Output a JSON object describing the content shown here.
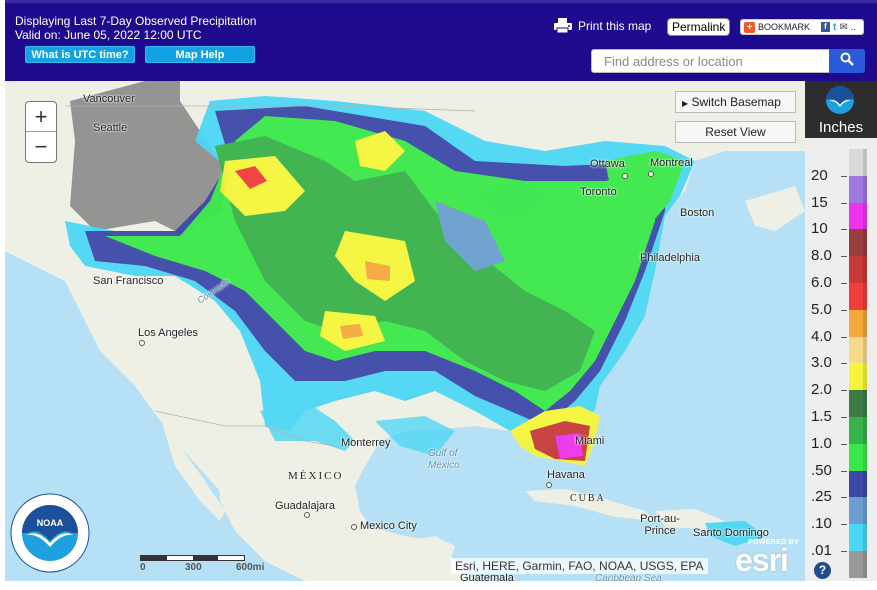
{
  "header": {
    "title_line1": "Displaying Last 7-Day Observed Precipitation",
    "title_line2": "Valid on: June 05, 2022 12:00 UTC",
    "utc_button": "What is UTC time?",
    "help_button": "Map Help",
    "print_label": "Print this map",
    "permalink_label": "Permalink",
    "bookmark_label": "BOOKMARK",
    "search_placeholder": "Find address or location"
  },
  "map": {
    "zoom_in": "+",
    "zoom_out": "−",
    "switch_basemap": "Switch Basemap",
    "reset_view": "Reset View",
    "attribution": "Esri, HERE, Garmin, FAO, NOAA, USGS, EPA",
    "esri_powered": "POWERED BY",
    "esri_logo": "esri",
    "scale": {
      "labels": [
        "0",
        "300",
        "600mi"
      ]
    },
    "places": [
      {
        "name": "Vancouver",
        "type": "city"
      },
      {
        "name": "Seattle",
        "type": "city"
      },
      {
        "name": "San Francisco",
        "type": "city"
      },
      {
        "name": "Los Angeles",
        "type": "city"
      },
      {
        "name": "Ottawa",
        "type": "city"
      },
      {
        "name": "Montreal",
        "type": "city"
      },
      {
        "name": "Toronto",
        "type": "city"
      },
      {
        "name": "Boston",
        "type": "city"
      },
      {
        "name": "Philadelphia",
        "type": "city"
      },
      {
        "name": "Monterrey",
        "type": "city"
      },
      {
        "name": "Miami",
        "type": "city"
      },
      {
        "name": "Havana",
        "type": "city"
      },
      {
        "name": "Guadalajara",
        "type": "city"
      },
      {
        "name": "Mexico City",
        "type": "city"
      },
      {
        "name": "Port-au-Prince",
        "type": "city"
      },
      {
        "name": "Santo Domingo",
        "type": "city"
      },
      {
        "name": "Guatemala",
        "type": "city"
      },
      {
        "name": "MÉXICO",
        "type": "country"
      },
      {
        "name": "CUBA",
        "type": "country"
      },
      {
        "name": "Gulf of Mexico",
        "type": "water"
      },
      {
        "name": "Caribbean Sea",
        "type": "water"
      },
      {
        "name": "Colorado",
        "type": "river"
      }
    ]
  },
  "legend": {
    "unit": "Inches",
    "help": "?",
    "bins": [
      {
        "label": "",
        "color": "#d9d9d9"
      },
      {
        "label": "20",
        "color": "#9e78e0"
      },
      {
        "label": "15",
        "color": "#ee33ee"
      },
      {
        "label": "10",
        "color": "#993d3d"
      },
      {
        "label": "8.0",
        "color": "#c73a3a"
      },
      {
        "label": "6.0",
        "color": "#f23d3d"
      },
      {
        "label": "5.0",
        "color": "#f5a83c"
      },
      {
        "label": "4.0",
        "color": "#f6d98b"
      },
      {
        "label": "3.0",
        "color": "#f5f53b"
      },
      {
        "label": "2.0",
        "color": "#3d7b45"
      },
      {
        "label": "1.5",
        "color": "#38b24a"
      },
      {
        "label": "1.0",
        "color": "#3ae84a"
      },
      {
        "label": ".50",
        "color": "#3b48a8"
      },
      {
        "label": ".25",
        "color": "#6a9fd0"
      },
      {
        "label": ".10",
        "color": "#4bd6f5"
      },
      {
        "label": ".01",
        "color": "#999999"
      }
    ]
  }
}
